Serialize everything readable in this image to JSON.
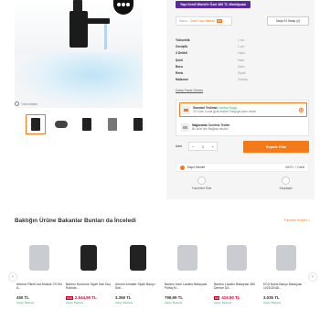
{
  "gallery": {
    "zoom_hint": "Yakınlaştır",
    "thumb_count": 6
  },
  "promo": {
    "badge": "Yapı Kredi World'e Özel 400 TL Worldpuan"
  },
  "seller": {
    "label": "Satıcı:",
    "name": "Çiveli Yapı Market",
    "score": "8.8",
    "fav_button": "Takip Et Satışı (0)"
  },
  "specs": [
    {
      "key": "Yükseklik",
      "value": "1 cm"
    },
    {
      "key": "Genişlik",
      "value": "1 cm"
    },
    {
      "key": "3 Delikli",
      "value": "Hayır"
    },
    {
      "key": "Şekil",
      "value": "Kare"
    },
    {
      "key": "Boru",
      "value": "Kablı"
    },
    {
      "key": "Renk",
      "value": "Siyah"
    },
    {
      "key": "Malzeme",
      "value": "Gümüş"
    }
  ],
  "all_features": "Daha Fazla Göster",
  "delivery": {
    "opt1_title": "Standart Teslimat",
    "opt1_tag": "Ücretsiz Kargo",
    "opt1_sub": "29 Ocak Cuma günü teslim! Kargoya yarın teslim",
    "opt2_title": "Mağazadan Ücretsiz Teslim",
    "opt2_sub": "Bu ürün için Mağaza seçiniz"
  },
  "cart": {
    "qty_label": "Adet",
    "qty_value": "1",
    "minus": "−",
    "plus": "+",
    "add_button": "Sepete Ekle"
  },
  "shipping": {
    "label": "Kapıl Hizmet",
    "value": "400TL + Dahil"
  },
  "actions": [
    {
      "label": "Favorilere Ekle"
    },
    {
      "label": "Karşılaştır"
    }
  ],
  "recommendations": {
    "title": "Baktığın Ürüne Bakanlar Bunları da İnceledi",
    "more": "Tümünü Keşfet >",
    "prev": "‹",
    "next": "›",
    "items": [
      {
        "name": "Artema Filtreli Ara Musluk 2'li Set A...",
        "price": "450 TL",
        "badge": "Kargo Bedava"
      },
      {
        "name": "Banbro Nocturne Siyah Satı Duş Robinle...",
        "price": "2.849,90 TL",
        "discount": "%10",
        "sale": "2.544,90 TL",
        "badge": "Kargo Bedava"
      },
      {
        "name": "Armoni Armatür Siyah Banyo Seti...",
        "price": "3.359 TL",
        "badge": "Kargo Bedava"
      },
      {
        "name": "Banbro Kare Lavabo Bataryası Portaj M...",
        "price": "799,99 TL",
        "badge": "Kargo Bedava"
      },
      {
        "name": "Banbro Lavabo Bataryası 360 Derece Dö...",
        "price": "419,90 TL",
        "discount": "%8",
        "badge": "Kargo Bedava"
      },
      {
        "name": "ECA Nobis Banyo Bataryası 102102048...",
        "price": "3.035 TL",
        "badge": "Kargo Bedava"
      }
    ]
  },
  "colors": {
    "accent": "#f27a1a",
    "promo": "#5a2a9c",
    "sale": "#d2042d",
    "success": "#0bc15c"
  }
}
